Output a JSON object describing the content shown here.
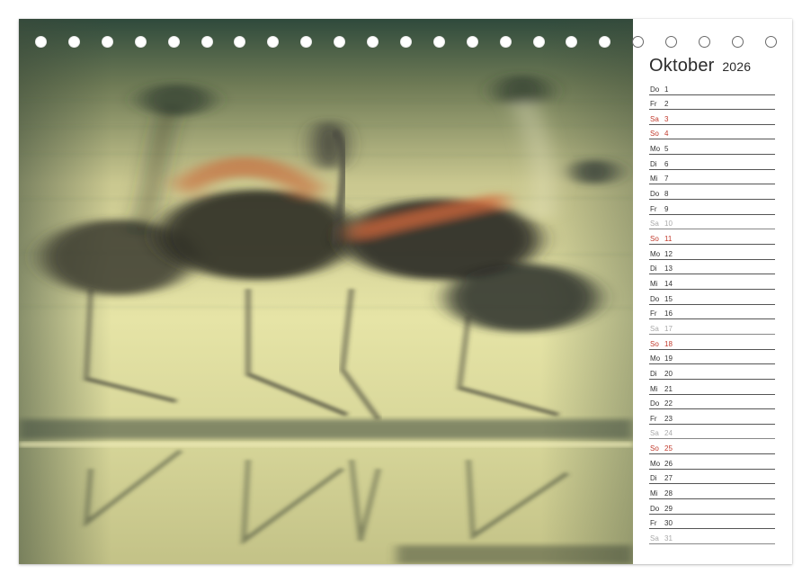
{
  "calendar": {
    "month": "Oktober",
    "year": "2026",
    "days": [
      {
        "dn": "Do",
        "d": "1",
        "kind": "weekday"
      },
      {
        "dn": "Fr",
        "d": "2",
        "kind": "weekday"
      },
      {
        "dn": "Sa",
        "d": "3",
        "kind": "sat-red"
      },
      {
        "dn": "So",
        "d": "4",
        "kind": "sun"
      },
      {
        "dn": "Mo",
        "d": "5",
        "kind": "weekday"
      },
      {
        "dn": "Di",
        "d": "6",
        "kind": "weekday"
      },
      {
        "dn": "Mi",
        "d": "7",
        "kind": "weekday"
      },
      {
        "dn": "Do",
        "d": "8",
        "kind": "weekday"
      },
      {
        "dn": "Fr",
        "d": "9",
        "kind": "weekday"
      },
      {
        "dn": "Sa",
        "d": "10",
        "kind": "sat-grey"
      },
      {
        "dn": "So",
        "d": "11",
        "kind": "sun"
      },
      {
        "dn": "Mo",
        "d": "12",
        "kind": "weekday"
      },
      {
        "dn": "Di",
        "d": "13",
        "kind": "weekday"
      },
      {
        "dn": "Mi",
        "d": "14",
        "kind": "weekday"
      },
      {
        "dn": "Do",
        "d": "15",
        "kind": "weekday"
      },
      {
        "dn": "Fr",
        "d": "16",
        "kind": "weekday"
      },
      {
        "dn": "Sa",
        "d": "17",
        "kind": "sat-grey"
      },
      {
        "dn": "So",
        "d": "18",
        "kind": "sun"
      },
      {
        "dn": "Mo",
        "d": "19",
        "kind": "weekday"
      },
      {
        "dn": "Di",
        "d": "20",
        "kind": "weekday"
      },
      {
        "dn": "Mi",
        "d": "21",
        "kind": "weekday"
      },
      {
        "dn": "Do",
        "d": "22",
        "kind": "weekday"
      },
      {
        "dn": "Fr",
        "d": "23",
        "kind": "weekday"
      },
      {
        "dn": "Sa",
        "d": "24",
        "kind": "sat-grey"
      },
      {
        "dn": "So",
        "d": "25",
        "kind": "sun"
      },
      {
        "dn": "Mo",
        "d": "26",
        "kind": "weekday"
      },
      {
        "dn": "Di",
        "d": "27",
        "kind": "weekday"
      },
      {
        "dn": "Mi",
        "d": "28",
        "kind": "weekday"
      },
      {
        "dn": "Do",
        "d": "29",
        "kind": "weekday"
      },
      {
        "dn": "Fr",
        "d": "30",
        "kind": "weekday"
      },
      {
        "dn": "Sa",
        "d": "31",
        "kind": "sat-grey"
      }
    ]
  },
  "colors": {
    "sunday": "#c0392b",
    "saturday_muted": "#a9a9a9",
    "text": "#333333"
  },
  "binding": {
    "holes_count": 23,
    "holes_on_photo": 18
  }
}
